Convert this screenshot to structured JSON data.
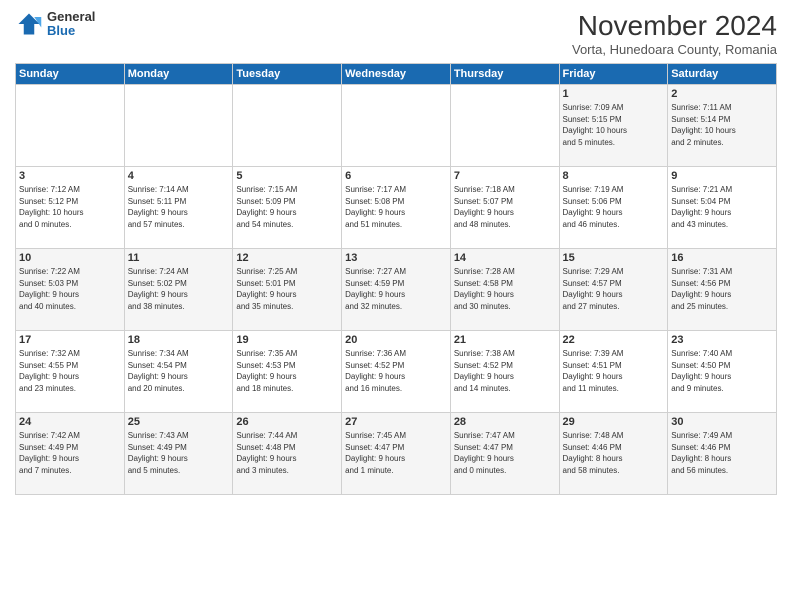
{
  "logo": {
    "general": "General",
    "blue": "Blue"
  },
  "header": {
    "month_title": "November 2024",
    "subtitle": "Vorta, Hunedoara County, Romania"
  },
  "days_of_week": [
    "Sunday",
    "Monday",
    "Tuesday",
    "Wednesday",
    "Thursday",
    "Friday",
    "Saturday"
  ],
  "weeks": [
    [
      {
        "day": "",
        "info": ""
      },
      {
        "day": "",
        "info": ""
      },
      {
        "day": "",
        "info": ""
      },
      {
        "day": "",
        "info": ""
      },
      {
        "day": "",
        "info": ""
      },
      {
        "day": "1",
        "info": "Sunrise: 7:09 AM\nSunset: 5:15 PM\nDaylight: 10 hours\nand 5 minutes."
      },
      {
        "day": "2",
        "info": "Sunrise: 7:11 AM\nSunset: 5:14 PM\nDaylight: 10 hours\nand 2 minutes."
      }
    ],
    [
      {
        "day": "3",
        "info": "Sunrise: 7:12 AM\nSunset: 5:12 PM\nDaylight: 10 hours\nand 0 minutes."
      },
      {
        "day": "4",
        "info": "Sunrise: 7:14 AM\nSunset: 5:11 PM\nDaylight: 9 hours\nand 57 minutes."
      },
      {
        "day": "5",
        "info": "Sunrise: 7:15 AM\nSunset: 5:09 PM\nDaylight: 9 hours\nand 54 minutes."
      },
      {
        "day": "6",
        "info": "Sunrise: 7:17 AM\nSunset: 5:08 PM\nDaylight: 9 hours\nand 51 minutes."
      },
      {
        "day": "7",
        "info": "Sunrise: 7:18 AM\nSunset: 5:07 PM\nDaylight: 9 hours\nand 48 minutes."
      },
      {
        "day": "8",
        "info": "Sunrise: 7:19 AM\nSunset: 5:06 PM\nDaylight: 9 hours\nand 46 minutes."
      },
      {
        "day": "9",
        "info": "Sunrise: 7:21 AM\nSunset: 5:04 PM\nDaylight: 9 hours\nand 43 minutes."
      }
    ],
    [
      {
        "day": "10",
        "info": "Sunrise: 7:22 AM\nSunset: 5:03 PM\nDaylight: 9 hours\nand 40 minutes."
      },
      {
        "day": "11",
        "info": "Sunrise: 7:24 AM\nSunset: 5:02 PM\nDaylight: 9 hours\nand 38 minutes."
      },
      {
        "day": "12",
        "info": "Sunrise: 7:25 AM\nSunset: 5:01 PM\nDaylight: 9 hours\nand 35 minutes."
      },
      {
        "day": "13",
        "info": "Sunrise: 7:27 AM\nSunset: 4:59 PM\nDaylight: 9 hours\nand 32 minutes."
      },
      {
        "day": "14",
        "info": "Sunrise: 7:28 AM\nSunset: 4:58 PM\nDaylight: 9 hours\nand 30 minutes."
      },
      {
        "day": "15",
        "info": "Sunrise: 7:29 AM\nSunset: 4:57 PM\nDaylight: 9 hours\nand 27 minutes."
      },
      {
        "day": "16",
        "info": "Sunrise: 7:31 AM\nSunset: 4:56 PM\nDaylight: 9 hours\nand 25 minutes."
      }
    ],
    [
      {
        "day": "17",
        "info": "Sunrise: 7:32 AM\nSunset: 4:55 PM\nDaylight: 9 hours\nand 23 minutes."
      },
      {
        "day": "18",
        "info": "Sunrise: 7:34 AM\nSunset: 4:54 PM\nDaylight: 9 hours\nand 20 minutes."
      },
      {
        "day": "19",
        "info": "Sunrise: 7:35 AM\nSunset: 4:53 PM\nDaylight: 9 hours\nand 18 minutes."
      },
      {
        "day": "20",
        "info": "Sunrise: 7:36 AM\nSunset: 4:52 PM\nDaylight: 9 hours\nand 16 minutes."
      },
      {
        "day": "21",
        "info": "Sunrise: 7:38 AM\nSunset: 4:52 PM\nDaylight: 9 hours\nand 14 minutes."
      },
      {
        "day": "22",
        "info": "Sunrise: 7:39 AM\nSunset: 4:51 PM\nDaylight: 9 hours\nand 11 minutes."
      },
      {
        "day": "23",
        "info": "Sunrise: 7:40 AM\nSunset: 4:50 PM\nDaylight: 9 hours\nand 9 minutes."
      }
    ],
    [
      {
        "day": "24",
        "info": "Sunrise: 7:42 AM\nSunset: 4:49 PM\nDaylight: 9 hours\nand 7 minutes."
      },
      {
        "day": "25",
        "info": "Sunrise: 7:43 AM\nSunset: 4:49 PM\nDaylight: 9 hours\nand 5 minutes."
      },
      {
        "day": "26",
        "info": "Sunrise: 7:44 AM\nSunset: 4:48 PM\nDaylight: 9 hours\nand 3 minutes."
      },
      {
        "day": "27",
        "info": "Sunrise: 7:45 AM\nSunset: 4:47 PM\nDaylight: 9 hours\nand 1 minute."
      },
      {
        "day": "28",
        "info": "Sunrise: 7:47 AM\nSunset: 4:47 PM\nDaylight: 9 hours\nand 0 minutes."
      },
      {
        "day": "29",
        "info": "Sunrise: 7:48 AM\nSunset: 4:46 PM\nDaylight: 8 hours\nand 58 minutes."
      },
      {
        "day": "30",
        "info": "Sunrise: 7:49 AM\nSunset: 4:46 PM\nDaylight: 8 hours\nand 56 minutes."
      }
    ]
  ]
}
